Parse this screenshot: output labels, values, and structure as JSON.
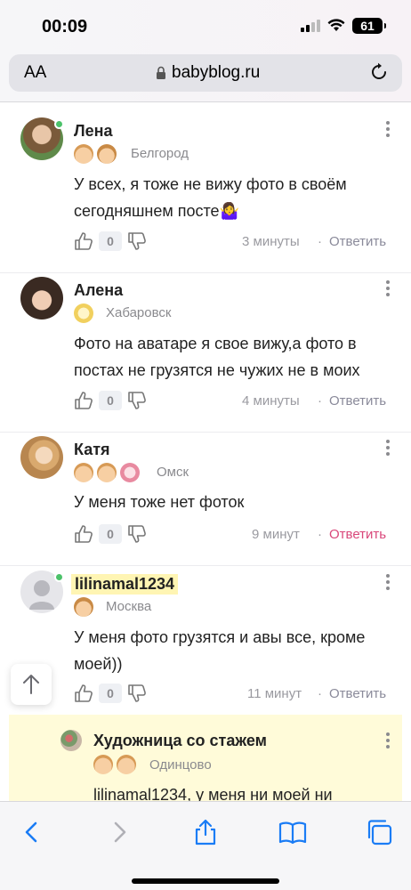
{
  "status": {
    "time": "00:09",
    "battery": "61"
  },
  "browser": {
    "aa_label": "AA",
    "url": "babyblog.ru"
  },
  "comments": [
    {
      "author": "Лена",
      "city": "Белгород",
      "text": "У всех, я тоже не вижу фото в своём сегодняшнем посте🤷‍♀️",
      "likes": "0",
      "time": "3 минуты",
      "reply": "Ответить"
    },
    {
      "author": "Алена",
      "city": "Хабаровск",
      "text": "Фото на аватаре я свое вижу,а фото в постах не грузятся не чужих не в моих",
      "likes": "0",
      "time": "4 минуты",
      "reply": "Ответить"
    },
    {
      "author": "Катя",
      "city": "Омск",
      "text": "У меня тоже нет фоток",
      "likes": "0",
      "time": "9 минут",
      "reply": "Ответить"
    },
    {
      "author": "lilinamal1234",
      "city": "Москва",
      "text": "У меня фото грузятся и авы все, кроме моей))",
      "likes": "0",
      "time": "11 минут",
      "reply": "Ответить"
    },
    {
      "author": "Художница со стажем",
      "city": "Одинцово",
      "text": "lilinamal1234, у меня ни моей ни"
    }
  ],
  "separator": "·",
  "colors": {
    "accent_pink": "#d9477a",
    "online": "#4cc26a",
    "highlight": "#fff5b3",
    "reply_bg": "#fffbd9"
  }
}
